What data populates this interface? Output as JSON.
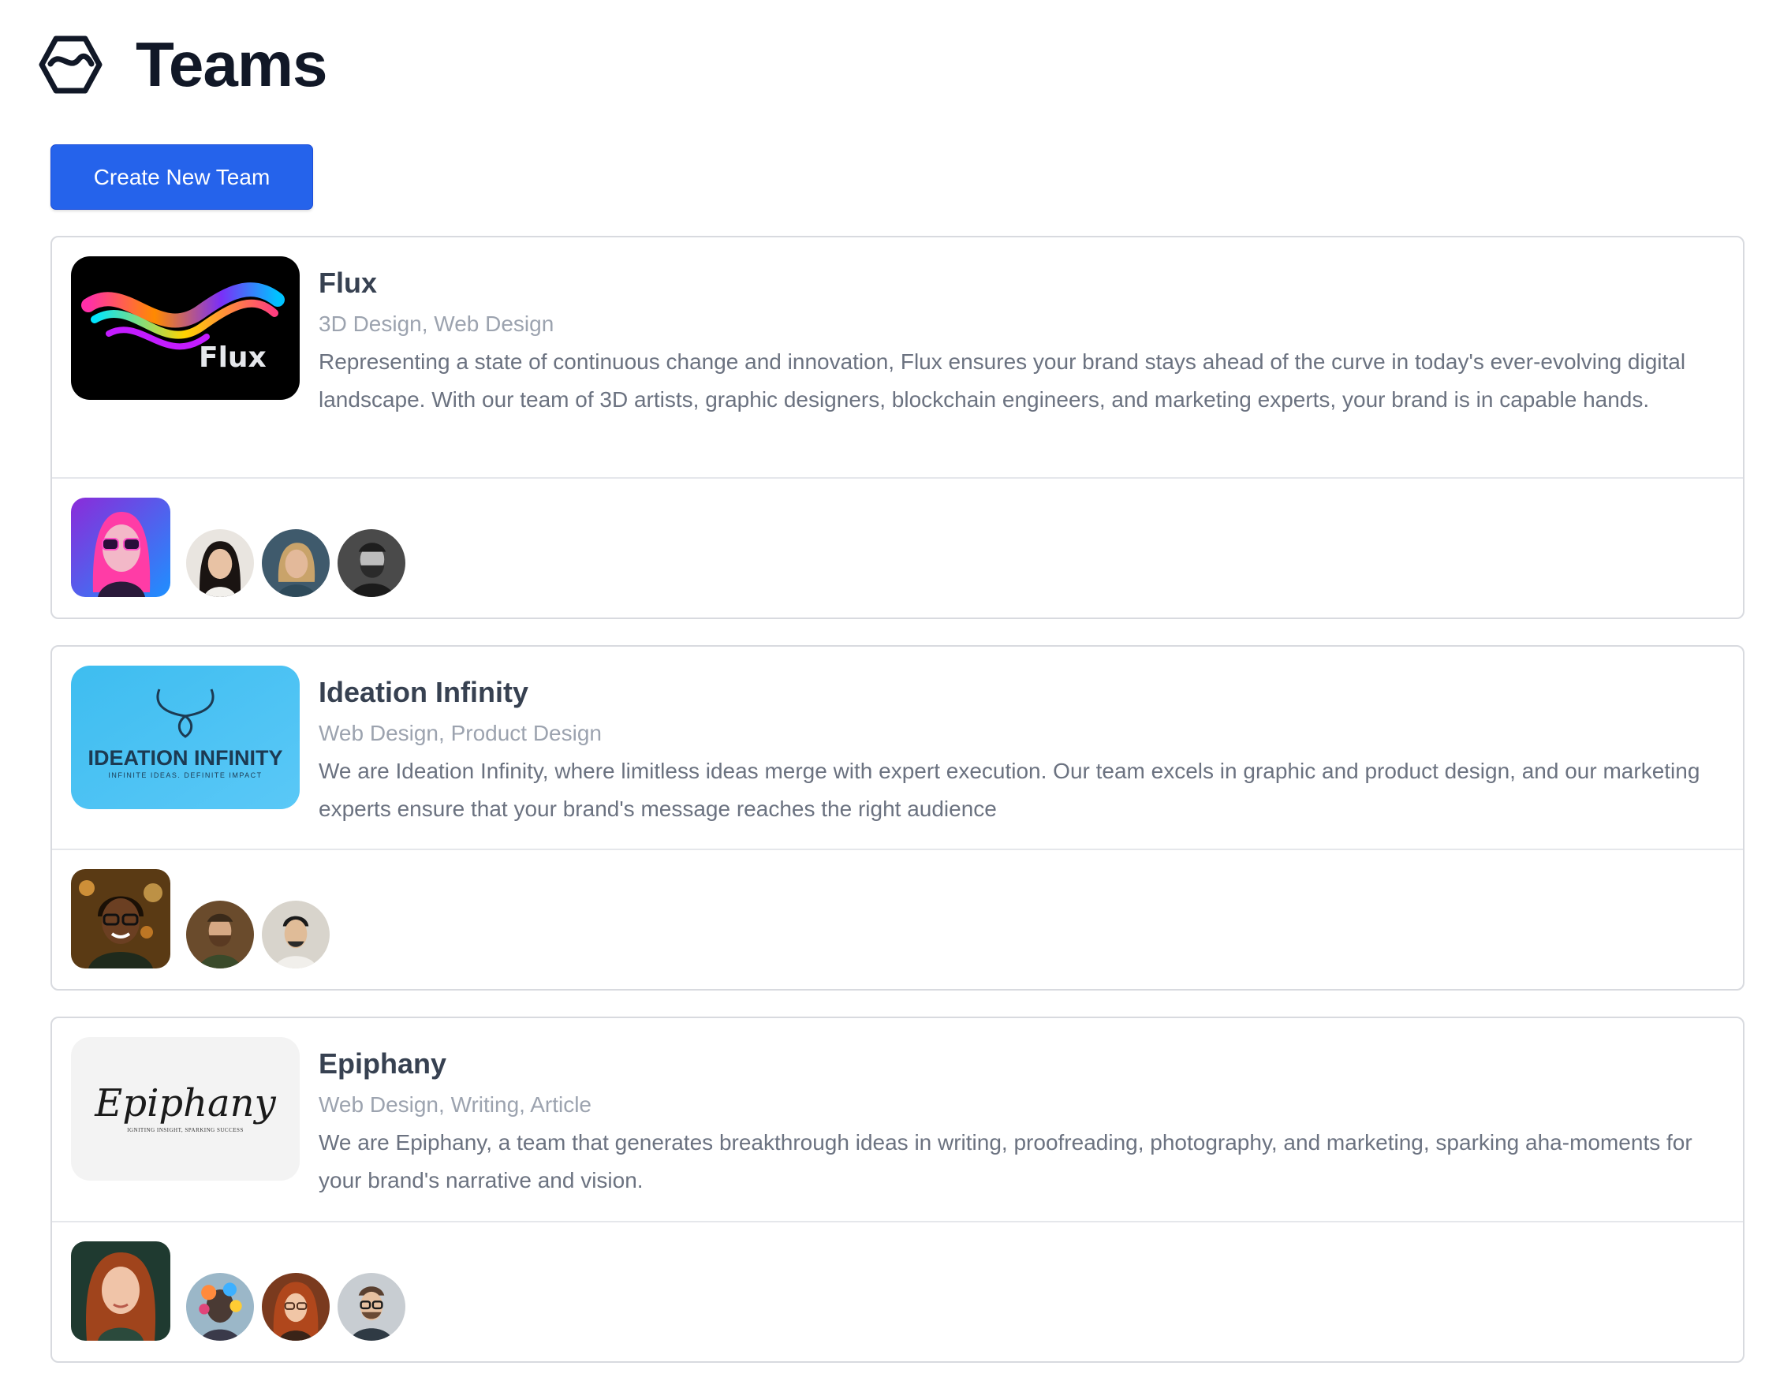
{
  "header": {
    "title": "Teams",
    "logo_icon": "hexagon-wave-logo-icon"
  },
  "actions": {
    "create_label": "Create New Team"
  },
  "teams": [
    {
      "name": "Flux",
      "tags": "3D Design, Web Design",
      "description": "Representing a state of continuous change and innovation, Flux ensures your brand stays ahead of the curve in today's ever-evolving digital landscape. With our team of 3D artists, graphic designers, blockchain engineers, and marketing experts, your brand is in capable hands.",
      "logo_text": "Flux",
      "lead": "neon-woman-sunglasses-avatar",
      "members": [
        "asian-woman-avatar",
        "blonde-woman-avatar",
        "bearded-man-bw-avatar"
      ]
    },
    {
      "name": "Ideation Infinity",
      "tags": "Web Design, Product Design",
      "description": "We are Ideation Infinity, where limitless ideas merge with expert execution. Our team excels in graphic and product design, and our marketing experts ensure that your brand's message reaches the right audience",
      "logo_title": "IDEATION INFINITY",
      "logo_subtitle": "INFINITE IDEAS. DEFINITE IMPACT",
      "lead": "smiling-man-glasses-avatar",
      "members": [
        "bearded-man-avatar",
        "asian-man-avatar"
      ]
    },
    {
      "name": "Epiphany",
      "tags": "Web Design, Writing, Article",
      "description": "We are Epiphany, a team that generates breakthrough ideas in writing, proofreading, photography, and marketing, sparking aha-moments for your brand's narrative and vision.",
      "logo_title": "Epiphany",
      "logo_subtitle": "IGNITING INSIGHT, SPARKING SUCCESS",
      "lead": "redhead-woman-avatar",
      "members": [
        "abstract-colorful-avatar",
        "red-hair-glasses-woman-avatar",
        "man-glasses-avatar"
      ]
    }
  ],
  "colors": {
    "primary": "#2563eb",
    "title": "#111827",
    "tag_gray": "#9ca3af",
    "body_gray": "#6b7280",
    "border": "#d8dadf"
  }
}
